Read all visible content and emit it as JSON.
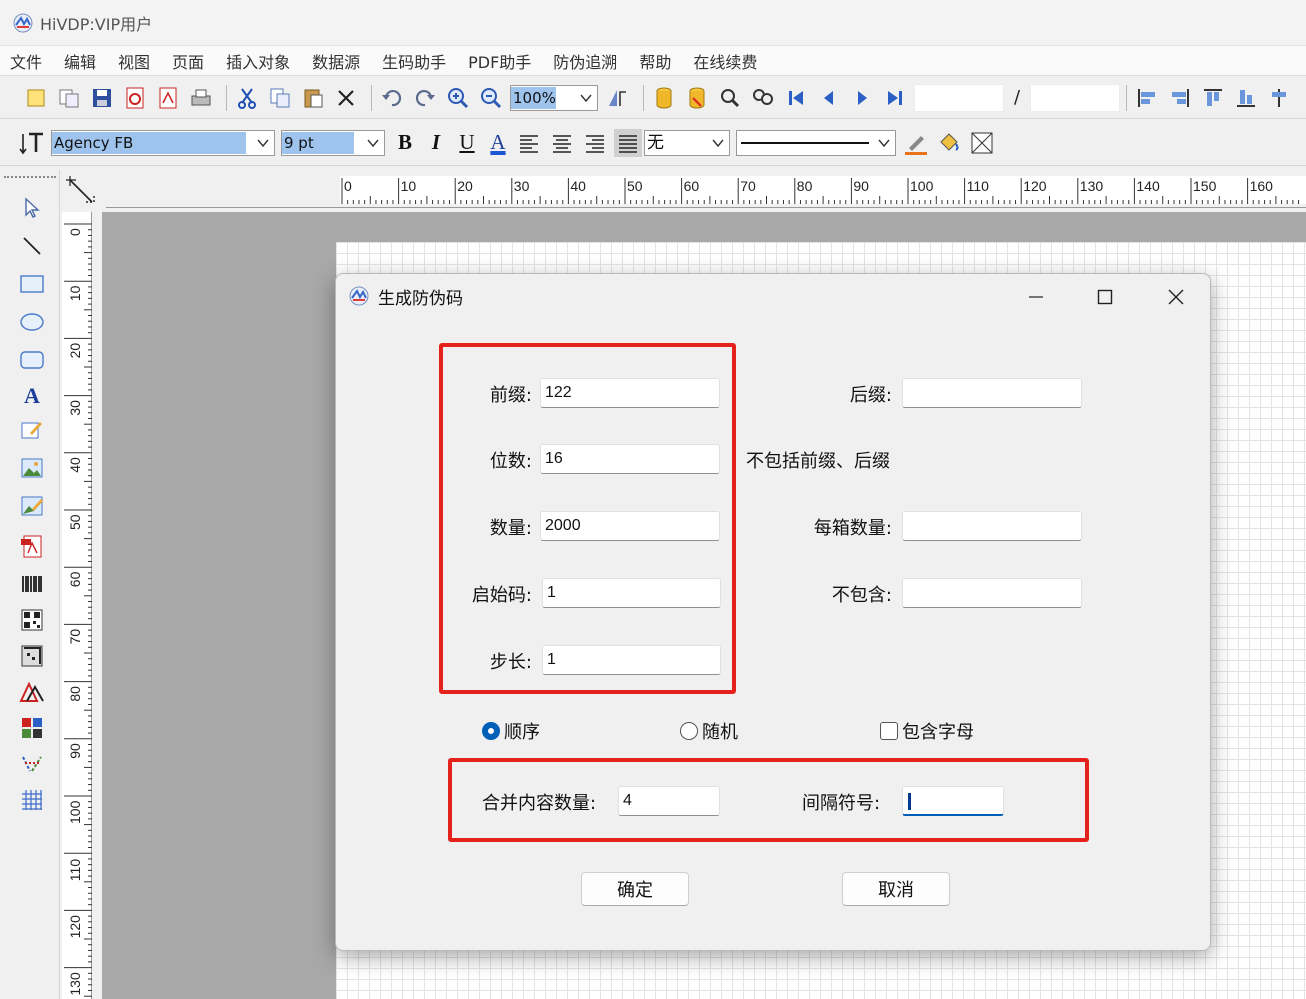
{
  "app": {
    "title": "HiVDP:VIP用户"
  },
  "menu": [
    "文件",
    "编辑",
    "视图",
    "页面",
    "插入对象",
    "数据源",
    "生码助手",
    "PDF助手",
    "防伪追溯",
    "帮助",
    "在线续费"
  ],
  "toolbar": {
    "zoom_value": "100%",
    "page_separator": "/",
    "font_name": "Agency FB",
    "font_size": "9 pt",
    "bold_label": "B",
    "italic_label": "I",
    "underline_label": "U",
    "font_color_label": "A",
    "border_value": "无"
  },
  "rulers": {
    "horizontal_ticks": [
      "0",
      "10",
      "20",
      "30",
      "40",
      "50",
      "60",
      "70",
      "80",
      "90",
      "100",
      "110",
      "120",
      "130",
      "140",
      "150",
      "160"
    ],
    "vertical_ticks": [
      "0",
      "10",
      "20",
      "30",
      "40",
      "50",
      "60",
      "70",
      "80",
      "90",
      "100",
      "110",
      "120",
      "130"
    ]
  },
  "palette": {
    "text_tool_label": "A"
  },
  "dialog": {
    "title": "生成防伪码",
    "prefix_label": "前缀:",
    "prefix_value": "122",
    "suffix_label": "后缀:",
    "suffix_value": "",
    "digits_label": "位数:",
    "digits_value": "16",
    "digits_note": "不包括前缀、后缀",
    "quantity_label": "数量:",
    "quantity_value": "2000",
    "per_box_label": "每箱数量:",
    "per_box_value": "",
    "start_label": "启始码:",
    "start_value": "1",
    "exclude_label": "不包含:",
    "exclude_value": "",
    "step_label": "步长:",
    "step_value": "1",
    "order_sequential": "顺序",
    "order_random": "随机",
    "include_letters": "包含字母",
    "merge_count_label": "合并内容数量:",
    "merge_count_value": "4",
    "separator_label": "间隔符号:",
    "separator_value": "",
    "ok_button": "确定",
    "cancel_button": "取消"
  },
  "colors": {
    "highlight_red": "#e5211c",
    "accent_blue": "#005fb8",
    "selection_blue": "#9ec3ec"
  }
}
